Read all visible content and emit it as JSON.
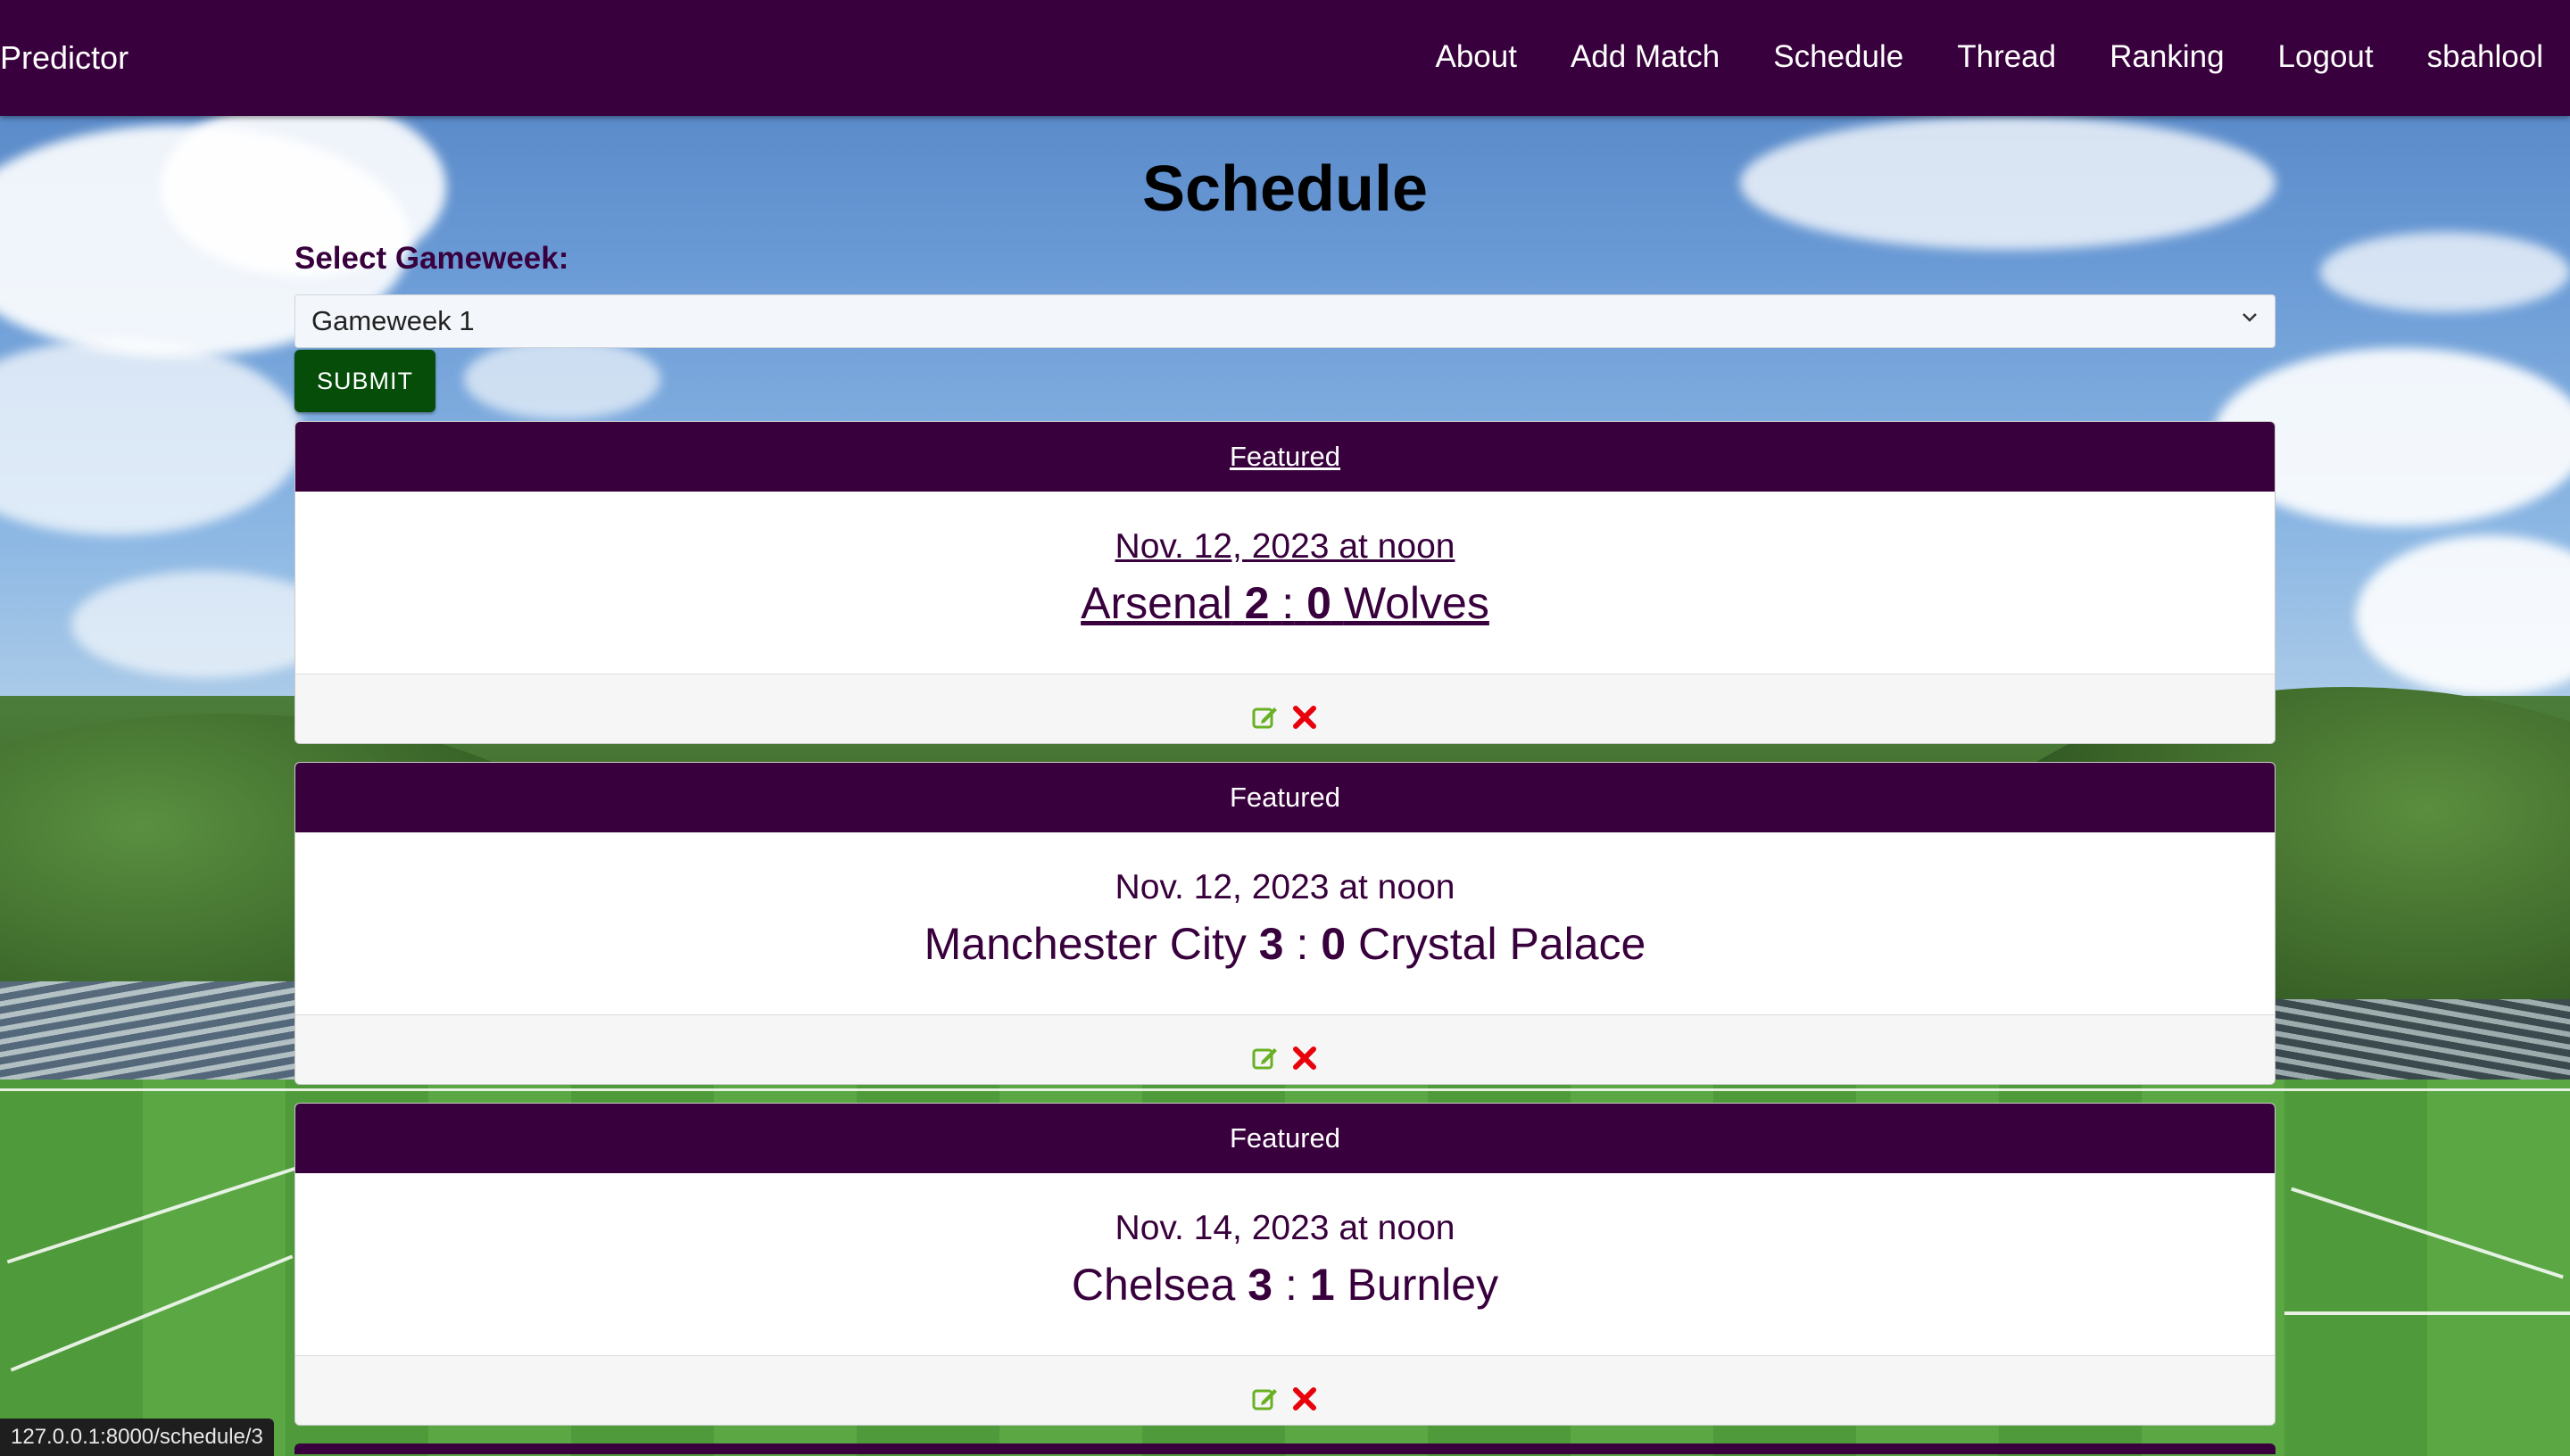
{
  "navbar": {
    "brand": "Predictor",
    "links": [
      "About",
      "Add Match",
      "Schedule",
      "Thread",
      "Ranking",
      "Logout",
      "sbahlool"
    ]
  },
  "page": {
    "title": "Schedule",
    "select_label": "Select Gameweek:",
    "select_value": "Gameweek 1",
    "submit_label": "SUBMIT"
  },
  "matches": [
    {
      "header": "Featured",
      "date": "Nov. 12, 2023 at noon",
      "home": "Arsenal",
      "home_score": "2",
      "sep": ":",
      "away_score": "0",
      "away": "Wolves"
    },
    {
      "header": "Featured",
      "date": "Nov. 12, 2023 at noon",
      "home": "Manchester City",
      "home_score": "3",
      "sep": ":",
      "away_score": "0",
      "away": "Crystal Palace"
    },
    {
      "header": "Featured",
      "date": "Nov. 14, 2023 at noon",
      "home": "Chelsea",
      "home_score": "3",
      "sep": ":",
      "away_score": "1",
      "away": "Burnley"
    }
  ],
  "icons": {
    "edit": "edit-icon",
    "delete": "delete-icon"
  },
  "colors": {
    "primary": "#38003c",
    "submit": "#064d0a",
    "edit_icon": "#6ab023",
    "delete_icon": "#e8000b"
  },
  "status_bar": {
    "url": "127.0.0.1:8000/schedule/3"
  }
}
